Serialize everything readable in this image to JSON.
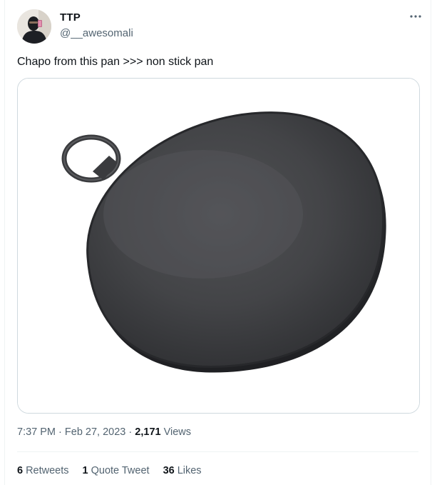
{
  "author": {
    "display_name": "TTP",
    "handle": "@__awesomali"
  },
  "menu_icon": "more-horizontal-icon",
  "tweet": {
    "text": "Chapo from this pan >>> non stick pan",
    "image_alt": "round dark cast iron flat pan with ring handle"
  },
  "meta": {
    "time": "7:37 PM",
    "separator1": "·",
    "date": "Feb 27, 2023",
    "separator2": "·",
    "views_count": "2,171",
    "views_label": "Views"
  },
  "stats": {
    "retweets_count": "6",
    "retweets_label": "Retweets",
    "quotes_count": "1",
    "quotes_label": "Quote Tweet",
    "likes_count": "36",
    "likes_label": "Likes"
  },
  "colors": {
    "text_primary": "#0f1419",
    "text_secondary": "#536471",
    "border": "#cfd9de",
    "pan": "#3f4043"
  }
}
